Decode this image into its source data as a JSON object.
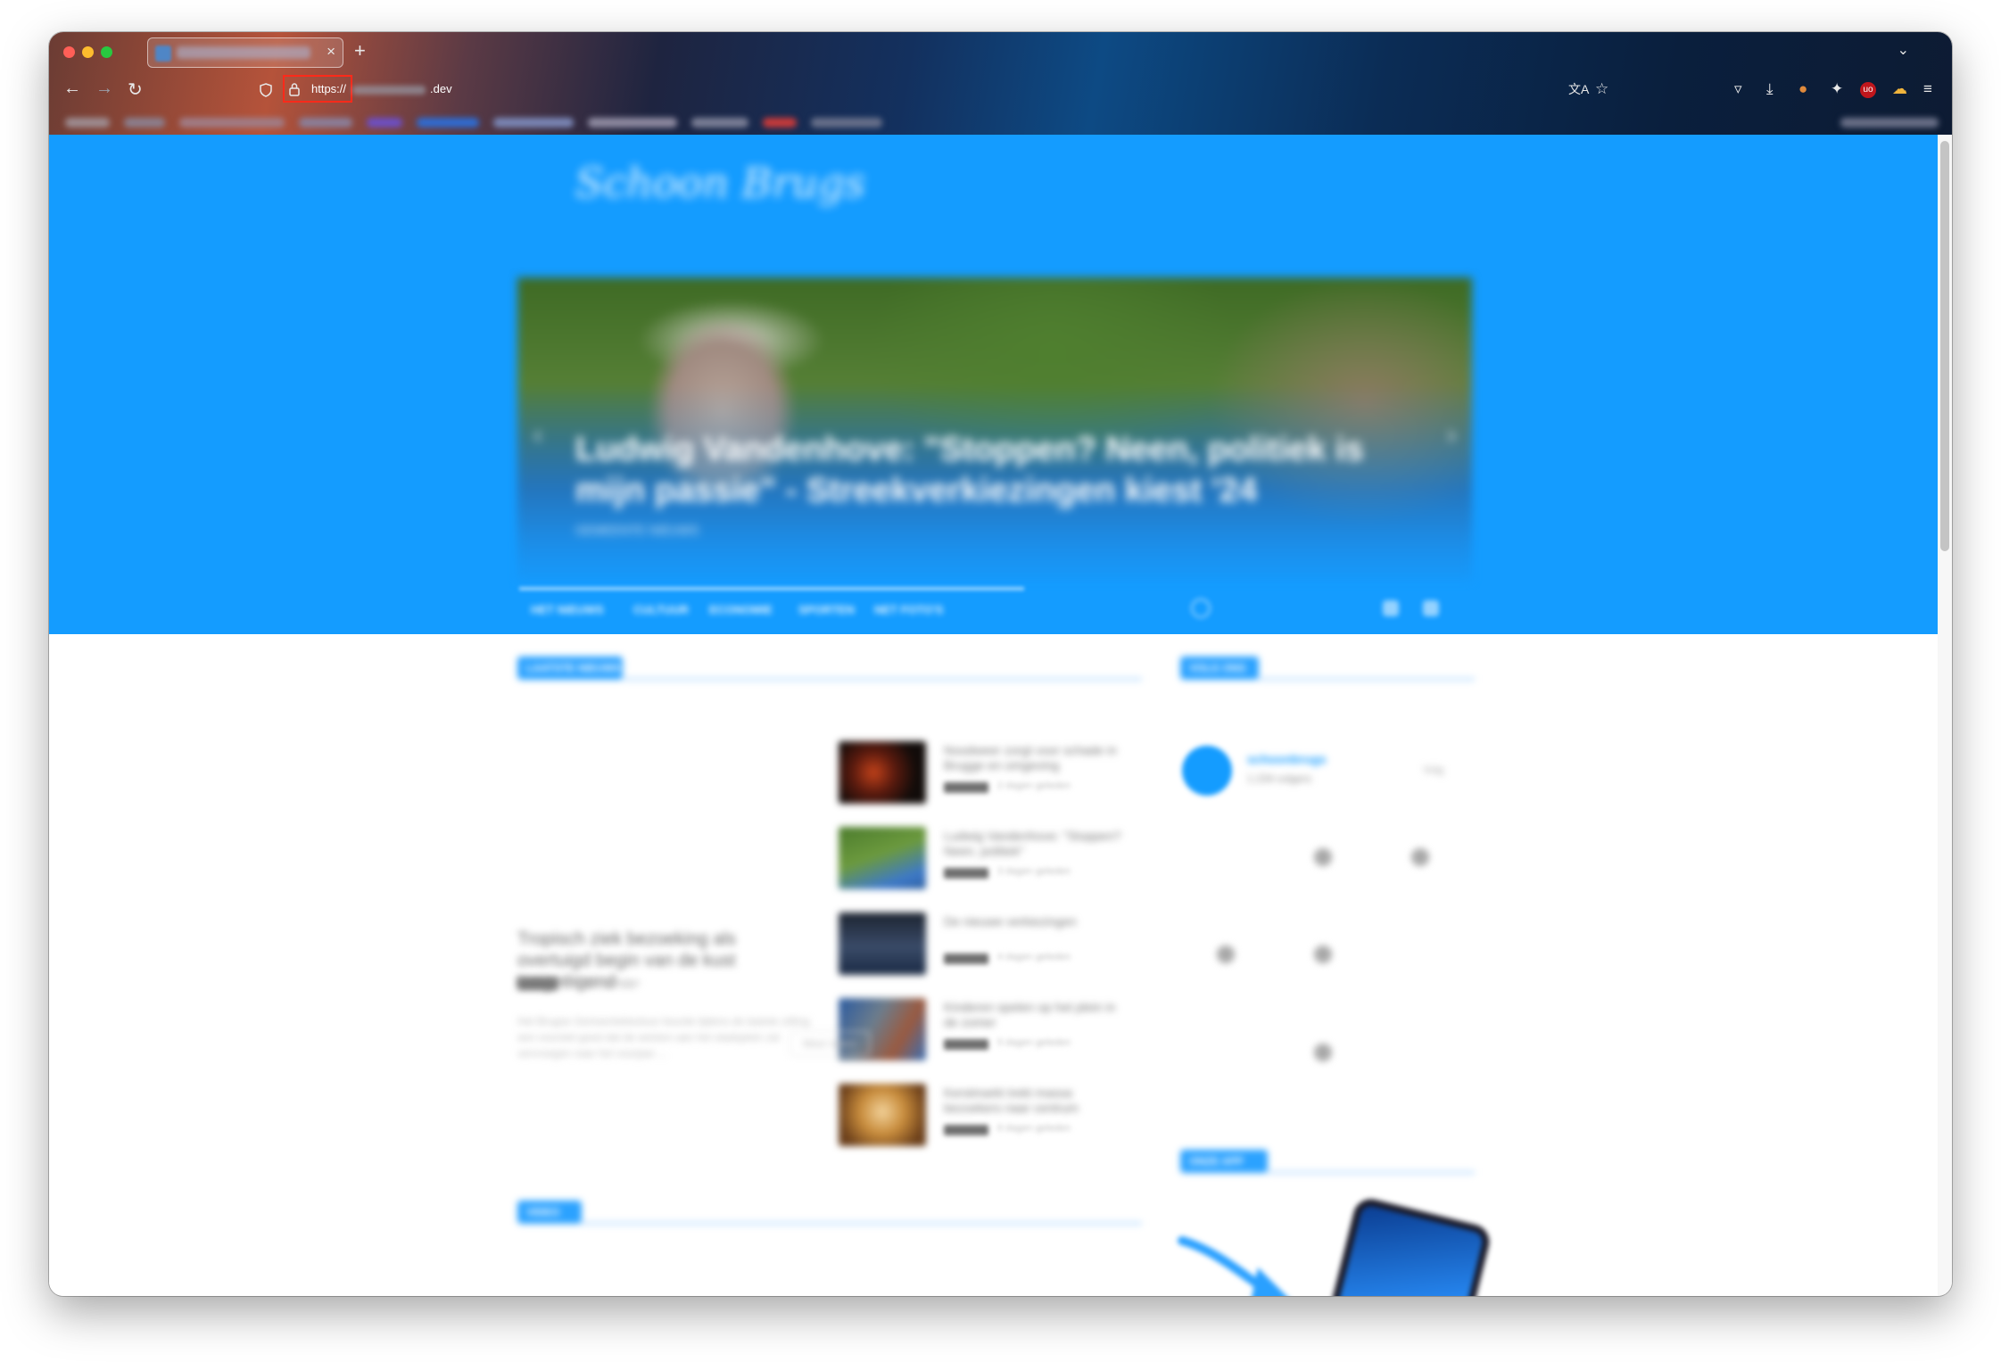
{
  "browser": {
    "tab": {
      "title": "",
      "close_icon": "×"
    },
    "new_tab_icon": "+",
    "tab_list_icon": "⌄",
    "nav": {
      "back": "←",
      "forward": "→",
      "reload": "↻"
    },
    "url": {
      "scheme": "https://",
      "tld": ".dev"
    },
    "toolbar_icons": {
      "translate": "文A",
      "bookmark_star": "☆",
      "pocket": "▿",
      "downloads": "⤓",
      "account": "●",
      "extensions": "✦",
      "ublock": "uo",
      "notification": "☁",
      "menu": "≡"
    },
    "bookmark_colors": [
      "#9d8c91",
      "#8b7f8e",
      "#a07c86",
      "#8a7f9a",
      "#6d4fc4",
      "#2f6cd2",
      "#7a86b5",
      "#8e8aa0",
      "#7b7f96",
      "#c93a3a",
      "#68708a"
    ]
  },
  "site": {
    "colors": {
      "primary": "#149cff",
      "section_line": "#b9ddff"
    },
    "logo_text": "Schoon Brugs",
    "hero": {
      "title": "Ludwig Vandenhove: \"Stoppen? Neen, politiek is mijn passie\" - Streekverkiezingen kiest '24",
      "meta": "GEMEENTE NIEUWS",
      "prev_icon": "‹",
      "next_icon": "›"
    },
    "nav_items": [
      "HET NIEUWS",
      "CULTUUR",
      "ECONOMIE",
      "SPORTEN",
      "NET FOTO'S"
    ],
    "sections": {
      "news_heading": "LAATSTE NIEUWS",
      "video_heading": "VIDEO",
      "social_heading": "VOLG ONS",
      "promo_heading": "ONZE APP"
    },
    "lead_article": {
      "title": "Tropisch ziek bezoeking als overtuigd begin van de kust toegeëigend ...",
      "tag": "NIEUWS",
      "date": "2 dagen geleden",
      "excerpt": "Het Brugse Gemeentebestuur keurde tijdens de laatste zitting een voorstel goed dat de werken aan het stadsplein zal vervroegen naar het voorjaar ..."
    },
    "posts": [
      {
        "title": "Noodweer zorgt voor schade in Brugge en omgeving",
        "tag": "NIEUWS",
        "date": "2 dagen geleden"
      },
      {
        "title": "Ludwig Vandenhove: \"Stoppen? Neen, politiek\"",
        "tag": "POLITIEK",
        "date": "3 dagen geleden"
      },
      {
        "title": "De nieuwe verkiezingen",
        "tag": "POLITIEK",
        "date": "4 dagen geleden"
      },
      {
        "title": "Kinderen spelen op het plein in de zomer",
        "tag": "NIEUWS",
        "date": "5 dagen geleden"
      },
      {
        "title": "Kerstmarkt trekt massa bezoekers naar centrum",
        "tag": "CULTUUR",
        "date": "6 dagen geleden"
      }
    ],
    "load_more": "Meer laden",
    "profile": {
      "name": "schoonbrugs",
      "sub": "1.234 volgers",
      "follow": "Volg"
    }
  }
}
